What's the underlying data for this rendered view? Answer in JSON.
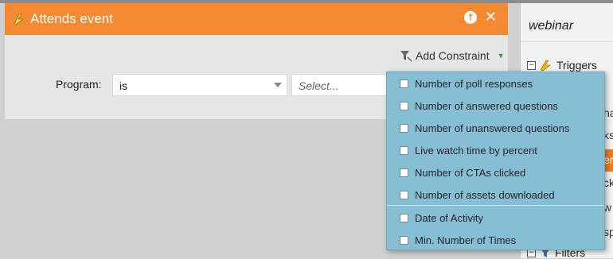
{
  "dialog": {
    "title": "Attends event",
    "add_constraint": "Add Constraint",
    "program_label": "Program:",
    "operator_value": "is",
    "value_placeholder": "Select..."
  },
  "constraint_menu": {
    "items": [
      "Number of poll responses",
      "Number of answered questions",
      "Number of unanswered questions",
      "Live watch time by percent",
      "Number of CTAs clicked",
      "Number of assets downloaded"
    ],
    "common_items": [
      "Date of Activity",
      "Min. Number of Times"
    ]
  },
  "side_panel": {
    "search_text": "webinar",
    "triggers_label": "Triggers",
    "filters_label": "Filters",
    "peek_text": [
      "ha",
      "ks",
      "er",
      "ck",
      "w",
      "sp"
    ]
  },
  "colors": {
    "title_bar": "#f58a32",
    "menu_bg": "#86bfd3"
  }
}
